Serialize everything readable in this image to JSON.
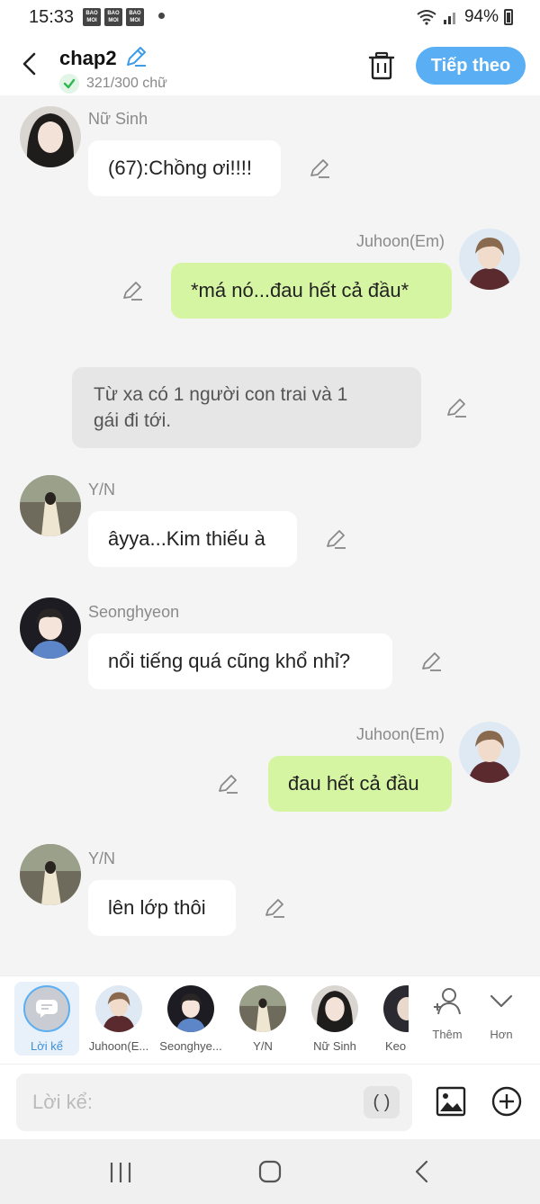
{
  "status": {
    "time": "15:33",
    "mini_badge": "BAO MOI",
    "battery": "94%"
  },
  "header": {
    "title": "chap2",
    "word_count": "321/300 chữ",
    "next_label": "Tiếp theo"
  },
  "messages": [
    {
      "name": "Nữ Sinh",
      "text": "(67):Chồng ơi!!!!"
    },
    {
      "name": "Juhoon(Em)",
      "text": "*má nó...đau hết cả đầu*"
    },
    {
      "text_line1": "Từ xa có 1 người con trai và 1",
      "text_line2": "gái đi tới."
    },
    {
      "name": "Y/N",
      "text": "âyya...Kim thiếu à"
    },
    {
      "name": "Seonghyeon",
      "text": "nổi tiếng quá cũng khổ nhỉ?"
    },
    {
      "name": "Juhoon(Em)",
      "text": "đau hết cả đầu"
    },
    {
      "name": "Y/N",
      "text": "lên lớp thôi"
    }
  ],
  "characters": {
    "narrator": "Lời kể",
    "items": [
      "Juhoon(E...",
      "Seonghye...",
      "Y/N",
      "Nữ Sinh",
      "Keo"
    ],
    "add_label": "Thêm",
    "more_label": "Hơn"
  },
  "input": {
    "placeholder": "Lời kể:",
    "paren": "( )"
  },
  "colors": {
    "accent": "#5aaef4",
    "green_bubble": "#d6f5a3",
    "narration_bubble": "#e6e6e6"
  }
}
